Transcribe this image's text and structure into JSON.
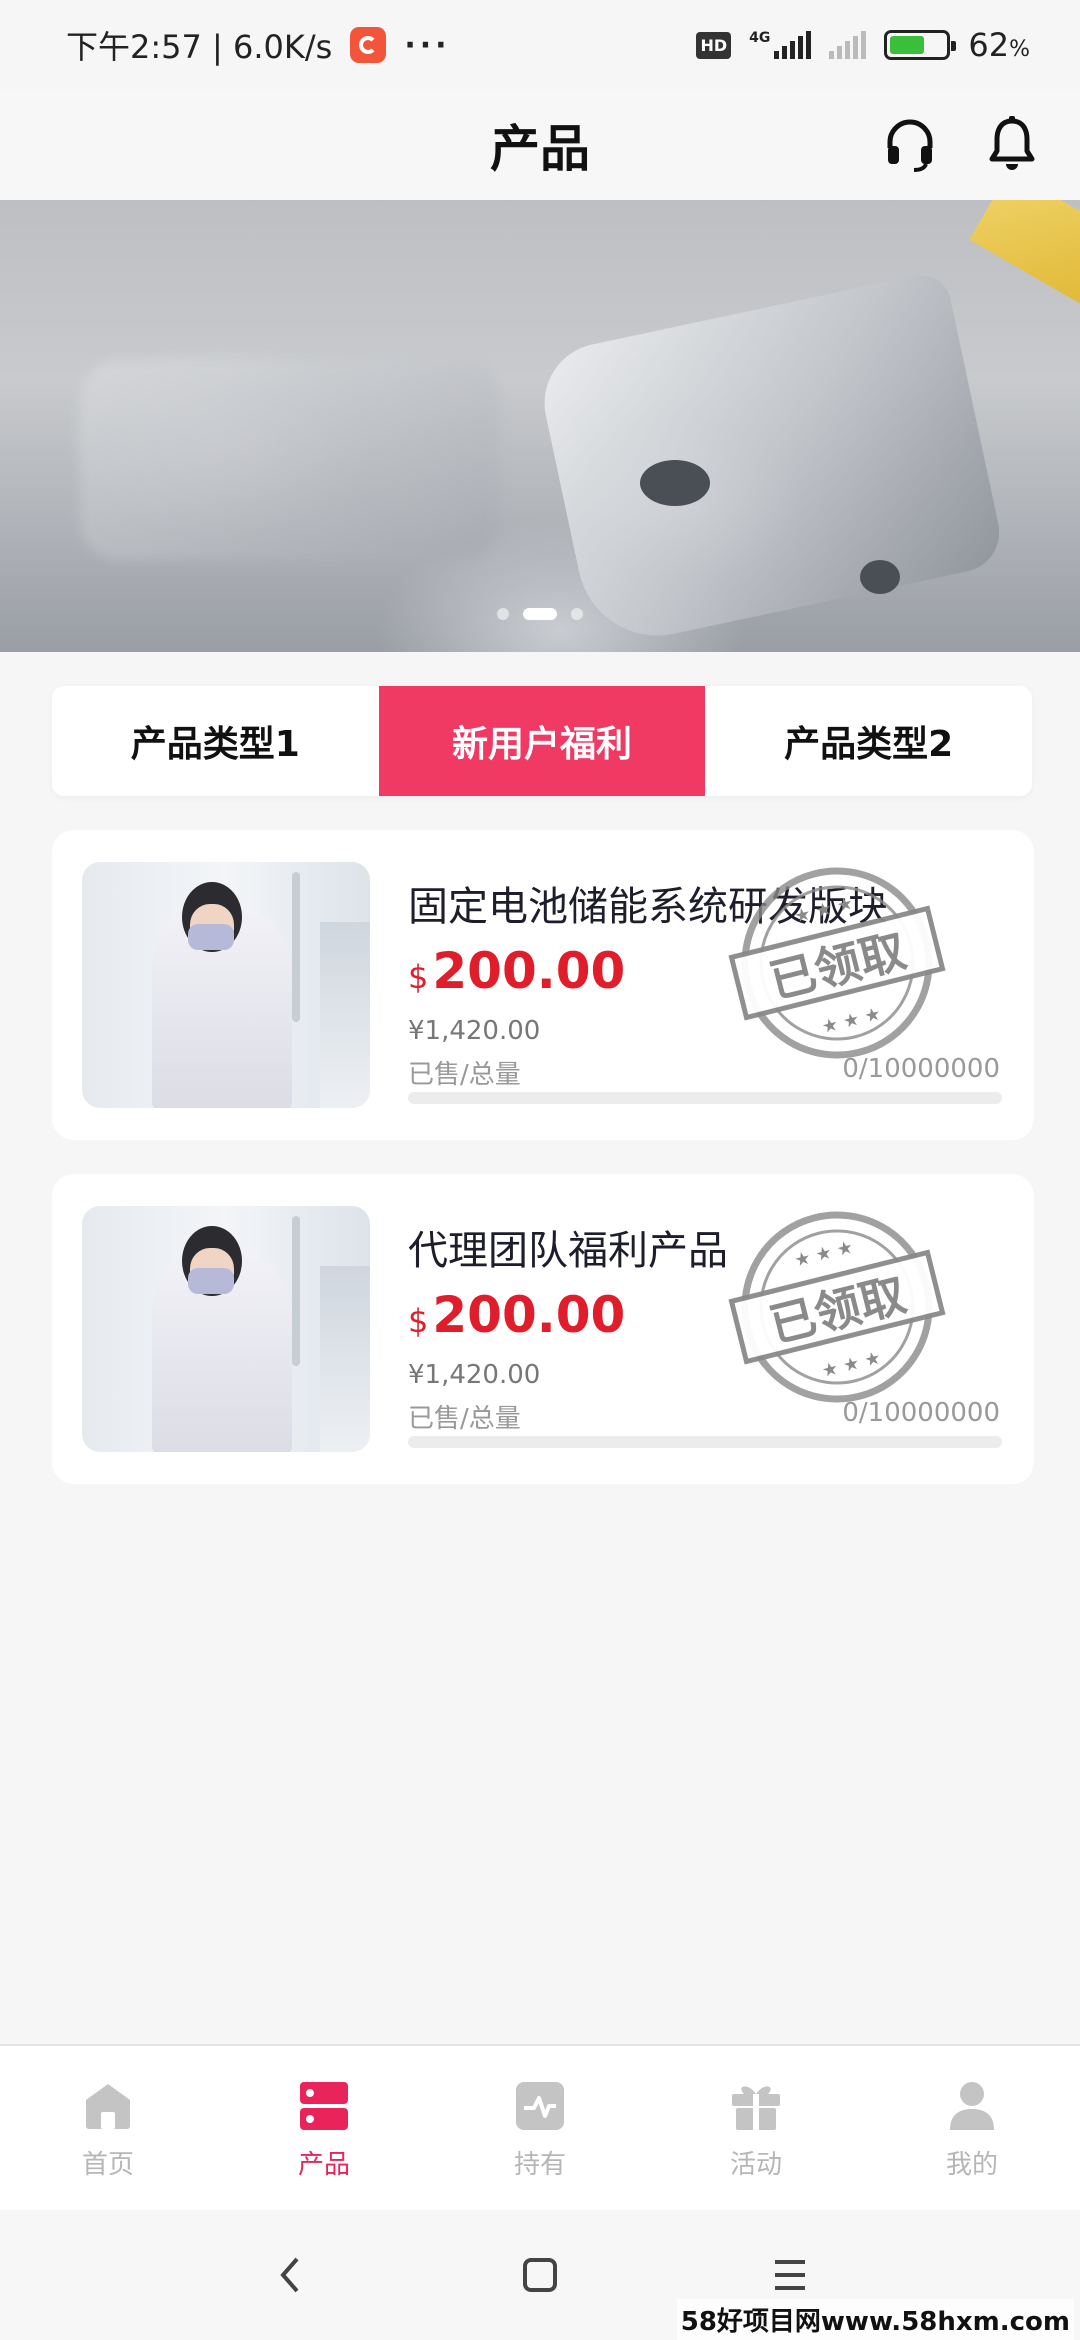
{
  "status_bar": {
    "time_speed": "下午2:57 | 6.0K/s",
    "more": "···",
    "hd": "HD",
    "net": "4G",
    "battery_pct": "62",
    "battery_unit": "%",
    "battery_level": 0.62
  },
  "header": {
    "title": "产品",
    "icons": [
      "headset-icon",
      "bell-icon"
    ]
  },
  "banner": {
    "slide_count": 3,
    "active_slide": 1
  },
  "tabs": [
    {
      "label": "产品类型1",
      "active": false
    },
    {
      "label": "新用户福利",
      "active": true
    },
    {
      "label": "产品类型2",
      "active": false
    }
  ],
  "products": [
    {
      "name": "固定电池储能系统研发版块",
      "currency": "$",
      "price": "200.00",
      "original_price": "¥1,420.00",
      "sold_label": "已售/总量",
      "sold_value": "0/10000000",
      "sold_fraction": 0,
      "stamp_text": "已领取"
    },
    {
      "name": "代理团队福利产品",
      "currency": "$",
      "price": "200.00",
      "original_price": "¥1,420.00",
      "sold_label": "已售/总量",
      "sold_value": "0/10000000",
      "sold_fraction": 0,
      "stamp_text": "已领取"
    }
  ],
  "bottom_nav": [
    {
      "label": "首页",
      "icon": "home-icon",
      "active": false
    },
    {
      "label": "产品",
      "icon": "product-icon",
      "active": true
    },
    {
      "label": "持有",
      "icon": "holdings-icon",
      "active": false
    },
    {
      "label": "活动",
      "icon": "gift-icon",
      "active": false
    },
    {
      "label": "我的",
      "icon": "user-icon",
      "active": false
    }
  ],
  "watermark": "58好项目网www.58hxm.com",
  "colors": {
    "accent": "#f03a63",
    "price": "#e01e2b",
    "nav_active": "#e8245b",
    "nav_inactive": "#c4c4c4"
  }
}
